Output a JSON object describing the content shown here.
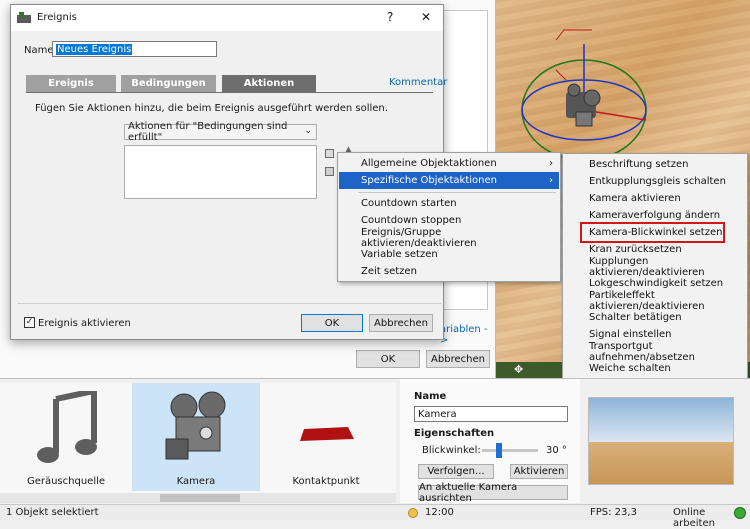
{
  "event_dialog": {
    "title": "Ereignis",
    "help_glyph": "?",
    "close_glyph": "✕",
    "name_label": "Name:",
    "name_value": "Neues Ereignis",
    "tabs": [
      "Ereignis",
      "Bedingungen",
      "Aktionen"
    ],
    "comment_link": "Kommentar",
    "instruction": "Fügen Sie Aktionen hinzu, die beim Ereignis ausgeführt werden sollen.",
    "actions_select": "Aktionen für \"Bedingungen sind erfüllt\"",
    "enable_checkbox_label": "Ereignis aktivieren",
    "ok_label": "OK",
    "cancel_label": "Abbrechen"
  },
  "background_dialog": {
    "variables_link": "ariablen ->",
    "ok_label": "OK",
    "cancel_label": "Abbrechen"
  },
  "context_menu": {
    "items": [
      "Allgemeine Objektaktionen",
      "Spezifische Objektaktionen",
      "Countdown starten",
      "Countdown stoppen",
      "Ereignis/Gruppe aktivieren/deaktivieren",
      "Variable setzen",
      "Zeit setzen"
    ],
    "arrow": "›"
  },
  "submenu": {
    "items": [
      "Beschriftung setzen",
      "Entkupplungsgleis schalten",
      "Kamera aktivieren",
      "Kameraverfolgung ändern",
      "Kamera-Blickwinkel setzen",
      "Kran zurücksetzen",
      "Kupplungen aktivieren/deaktivieren",
      "Lokgeschwindigkeit setzen",
      "Partikeleffekt aktivieren/deaktivieren",
      "Schalter betätigen",
      "Signal einstellen",
      "Transportgut aufnehmen/absetzen",
      "Weiche schalten"
    ],
    "highlighted_index": 4,
    "highlight_color": "#d01818"
  },
  "catalog": {
    "items": [
      "Geräuschquelle",
      "Kamera",
      "Kontaktpunkt"
    ],
    "selected_index": 1
  },
  "properties": {
    "name_heading": "Name",
    "name_value": "Kamera",
    "props_heading": "Eigenschaften",
    "angle_label": "Blickwinkel:",
    "angle_value": "30 °",
    "angle_fraction": 0.3,
    "follow_button": "Verfolgen...",
    "activate_button": "Aktivieren",
    "align_button": "An aktuelle Kamera ausrichten"
  },
  "statusbar": {
    "selection": "1 Objekt selektiert",
    "time": "12:00",
    "fps": "FPS: 23,3",
    "mode": "Online arbeiten"
  },
  "colors": {
    "menu_highlight": "#1d63c8",
    "name_selection": "#0078d7",
    "red_contact": "#b01212"
  }
}
